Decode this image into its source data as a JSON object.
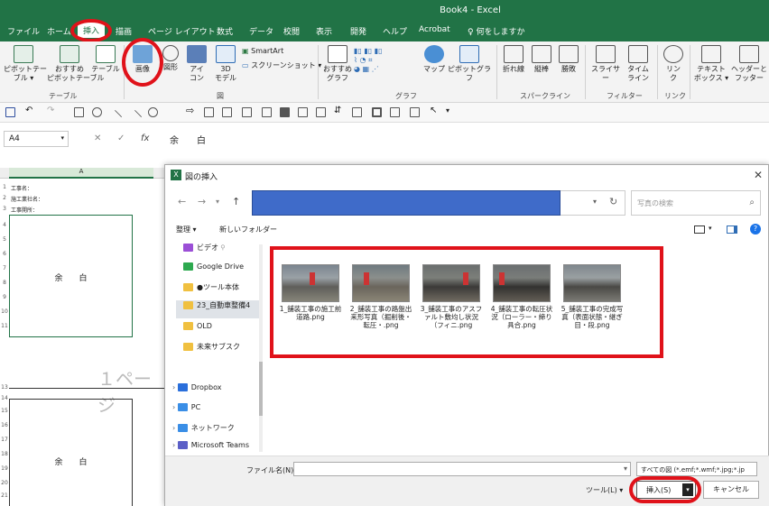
{
  "window": {
    "title": "Book4 - Excel"
  },
  "tabs": [
    "ファイル",
    "ホーム",
    "挿入",
    "描画",
    "ページ レイアウト",
    "数式",
    "データ",
    "校閲",
    "表示",
    "開発",
    "ヘルプ",
    "Acrobat"
  ],
  "tell_me": "何をしますか",
  "ribbon": {
    "pivot": "ピボットテー\nブル ▾",
    "recommended_pivot": "おすすめ\nピボットテーブル",
    "table": "テーブル",
    "group_table": "テーブル",
    "picture": "画像",
    "shapes": "図形",
    "icons": "アイ\nコン",
    "models3d": "3D\nモデル",
    "smartart": "SmartArt",
    "screenshot": "スクリーンショット ▾",
    "group_figure": "図",
    "recommended_charts": "おすすめ\nグラフ",
    "map": "マップ",
    "pivot_chart": "ピボットグラフ",
    "group_chart": "グラフ",
    "sparkline_line": "折れ線",
    "sparkline_column": "縦棒",
    "sparkline_winloss": "勝敗",
    "group_sparkline": "スパークライン",
    "slicer": "スライサー",
    "timeline": "タイム\nライン",
    "group_filter": "フィルター",
    "link": "リン\nク",
    "group_link": "リンク",
    "textbox": "テキスト\nボックス ▾",
    "header_footer": "ヘッダーと\nフッター"
  },
  "formula_bar": {
    "name_box": "A4",
    "cancel": "✕",
    "enter": "✓",
    "fx": "fx",
    "value": "余　　白"
  },
  "sheet": {
    "column_a": "A",
    "rows": [
      "1",
      "2",
      "3",
      "4",
      "5",
      "6",
      "7",
      "8",
      "9",
      "10",
      "11",
      "12",
      "13",
      "14",
      "15",
      "16",
      "17",
      "18",
      "19",
      "20",
      "21",
      "22"
    ],
    "row1": "工事名：",
    "row2": "施工業社名：",
    "row3": "工事開所：",
    "cell_text_top": "余　　白",
    "cell_text_bottom": "余　　白",
    "page_watermark": "１ページ"
  },
  "dialog": {
    "title": "図の挿入",
    "search_placeholder": "写真の検索",
    "organize": "整理 ▾",
    "new_folder": "新しいフォルダー",
    "nav_items": [
      {
        "label": "ビデオ",
        "icon": "video-folder-icon",
        "color": "#9b4fd6"
      },
      {
        "label": "Google Drive",
        "icon": "google-drive-icon",
        "color": "#2da94f"
      },
      {
        "label": "●ツール本体",
        "icon": "folder-icon",
        "color": "#f0c040"
      },
      {
        "label": "23_自動車整備4",
        "icon": "folder-icon",
        "color": "#f0c040"
      },
      {
        "label": "OLD",
        "icon": "folder-icon",
        "color": "#f0c040"
      },
      {
        "label": "未来サブスク",
        "icon": "folder-icon",
        "color": "#f0c040"
      },
      {
        "label": "Dropbox",
        "icon": "dropbox-icon",
        "color": "#2a6fdb"
      },
      {
        "label": "PC",
        "icon": "pc-icon",
        "color": "#3a8ee6"
      },
      {
        "label": "ネットワーク",
        "icon": "network-icon",
        "color": "#3a8ee6"
      },
      {
        "label": "Microsoft Teams",
        "icon": "teams-icon",
        "color": "#5b5fc7"
      }
    ],
    "files": [
      "1_舗装工事の施工前道路.png",
      "2_舗装工事の路盤出来形写真（掘削後・転圧・.png",
      "3_舗装工事のアスファルト敷均し状況（フィニ.png",
      "4_舗装工事の転圧状況（ローラー・締り具合.png",
      "5_舗装工事の完成写真（表面状態・継ぎ目・段.png"
    ],
    "file_name_label": "ファイル名(N):",
    "file_name_value": "",
    "file_type": "すべての図 (*.emf;*.wmf;*.jpg;*.jp",
    "tools": "ツール(L) ▾",
    "insert": "挿入(S)",
    "cancel": "キャンセル"
  },
  "colors": {
    "excel_green": "#217346",
    "highlight_red": "#e0121a",
    "address_blue": "#3f6bc9"
  }
}
